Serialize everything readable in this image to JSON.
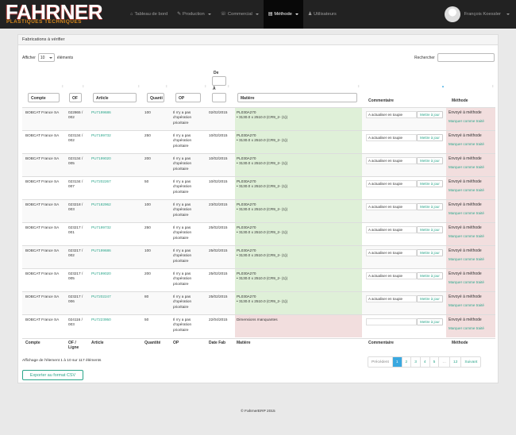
{
  "brand": {
    "name": "FAHRNER",
    "tagline": "PLASTIQUES TECHNIQUES"
  },
  "nav": {
    "items": [
      {
        "icon": "home-icon",
        "glyph": "⌂",
        "label": "Tableau de bord",
        "caret": false,
        "active": false
      },
      {
        "icon": "wrench-icon",
        "glyph": "✎",
        "label": "Production",
        "caret": true,
        "active": false
      },
      {
        "icon": "phone-icon",
        "glyph": "☏",
        "label": "Commercial",
        "caret": true,
        "active": false
      },
      {
        "icon": "book-icon",
        "glyph": "▤",
        "label": "Méthode",
        "caret": true,
        "active": true
      },
      {
        "icon": "user-icon",
        "glyph": "♟",
        "label": "Utilisateurs",
        "caret": false,
        "active": false
      }
    ]
  },
  "user": {
    "name": "François Koessler"
  },
  "panel": {
    "title": "Fabrications à vérifier"
  },
  "length": {
    "prefix": "Afficher",
    "value": "10",
    "suffix": "éléments"
  },
  "search": {
    "label": "Rechercher",
    "value": ""
  },
  "filters": {
    "compte": "Compte",
    "of": "OF",
    "article": "Article",
    "quantite": "Quanti",
    "op": "OP",
    "date_from": "De",
    "date_to": "À",
    "matiere": "Matière"
  },
  "headers": {
    "commentaire": "Commentaire",
    "methode": "Méthode"
  },
  "footer_headers": {
    "compte": "Compte",
    "of": "OF / Ligne",
    "article": "Article",
    "quantite": "Quantité",
    "op": "OP",
    "date": "Date Fab",
    "matiere": "Matière",
    "commentaire": "Commentaire",
    "methode": "Méthode"
  },
  "rows": [
    {
      "compte": "BOBCAT France SA",
      "of": "022865 / 002",
      "article": "PU7199686",
      "qty": "100",
      "op": "Il n'y a pas d'opération prioritaire",
      "date": "02/02/2015",
      "mat1": "PL030A270",
      "mat2": "• 3130.0 x 2510.0 (CR9_2- (1))",
      "mat_ok": true,
      "comment": "A actualiser en toupie",
      "update": "Mettre à jour",
      "status": "Envoyé à méthode",
      "mark": "Marquer comme traité"
    },
    {
      "compte": "BOBCAT France SA",
      "of": "023134 / 002",
      "article": "PU7199732",
      "qty": "250",
      "op": "Il n'y a pas d'opération prioritaire",
      "date": "10/02/2015",
      "mat1": "PL030A270",
      "mat2": "• 3130.0 x 2510.0 (CR9_2- (1))",
      "mat_ok": true,
      "comment": "A actualiser en toupie",
      "update": "Mettre à jour",
      "status": "Envoyé à méthode",
      "mark": "Marquer comme traité"
    },
    {
      "compte": "BOBCAT France SA",
      "of": "023134 / 005",
      "article": "PU7199020",
      "qty": "200",
      "op": "Il n'y a pas d'opération prioritaire",
      "date": "10/02/2015",
      "mat1": "PL030A270",
      "mat2": "• 3130.0 x 2510.0 (CR9_2- (1))",
      "mat_ok": true,
      "comment": "A actualiser en toupie",
      "update": "Mettre à jour",
      "status": "Envoyé à méthode",
      "mark": "Marquer comme traité"
    },
    {
      "compte": "BOBCAT France SA",
      "of": "023134 / 007",
      "article": "PU7202267",
      "qty": "50",
      "op": "Il n'y a pas d'opération prioritaire",
      "date": "10/02/2015",
      "mat1": "PL030A270",
      "mat2": "• 3130.0 x 2510.0 (CR9_2- (1))",
      "mat_ok": true,
      "comment": "A actualiser en toupie",
      "update": "Mettre à jour",
      "status": "Envoyé à méthode",
      "mark": "Marquer comme traité"
    },
    {
      "compte": "BOBCAT France SA",
      "of": "023218 / 003",
      "article": "PU7182962",
      "qty": "100",
      "op": "Il n'y a pas d'opération prioritaire",
      "date": "23/02/2015",
      "mat1": "PL030A270",
      "mat2": "• 3130.0 x 2510.0 (CR9_2- (1))",
      "mat_ok": true,
      "comment": "A actualiser en toupie",
      "update": "Mettre à jour",
      "status": "Envoyé à méthode",
      "mark": "Marquer comme traité"
    },
    {
      "compte": "BOBCAT France SA",
      "of": "023217 / 001",
      "article": "PU7199732",
      "qty": "250",
      "op": "Il n'y a pas d'opération prioritaire",
      "date": "25/02/2015",
      "mat1": "PL030A270",
      "mat2": "• 3130.0 x 2510.0 (CR9_2- (1))",
      "mat_ok": true,
      "comment": "A actualiser en toupie",
      "update": "Mettre à jour",
      "status": "Envoyé à méthode",
      "mark": "Marquer comme traité"
    },
    {
      "compte": "BOBCAT France SA",
      "of": "023217 / 002",
      "article": "PU7199686",
      "qty": "100",
      "op": "Il n'y a pas d'opération prioritaire",
      "date": "25/02/2015",
      "mat1": "PL030A270",
      "mat2": "• 3130.0 x 2510.0 (CR9_2- (1))",
      "mat_ok": true,
      "comment": "A actualiser en toupie",
      "update": "Mettre à jour",
      "status": "Envoyé à méthode",
      "mark": "Marquer comme traité"
    },
    {
      "compte": "BOBCAT France SA",
      "of": "023217 / 005",
      "article": "PU7199020",
      "qty": "200",
      "op": "Il n'y a pas d'opération prioritaire",
      "date": "25/02/2015",
      "mat1": "PL030A270",
      "mat2": "• 3130.0 x 2510.0 (CR9_2- (1))",
      "mat_ok": true,
      "comment": "A actualiser en toupie",
      "update": "Mettre à jour",
      "status": "Envoyé à méthode",
      "mark": "Marquer comme traité"
    },
    {
      "compte": "BOBCAT France SA",
      "of": "023217 / 006",
      "article": "PU7202247",
      "qty": "80",
      "op": "Il n'y a pas d'opération prioritaire",
      "date": "25/02/2015",
      "mat1": "PL030A270",
      "mat2": "• 3130.0 x 2510.0 (CR9_2- (1))",
      "mat_ok": true,
      "comment": "A actualiser en toupie",
      "update": "Mettre à jour",
      "status": "Envoyé à méthode",
      "mark": "Marquer comme traité"
    },
    {
      "compte": "BOBCAT France SA",
      "of": "024116 / 003",
      "article": "PU7223950",
      "qty": "50",
      "op": "Il n'y a pas d'opération prioritaire",
      "date": "22/04/2015",
      "mat1": "Dimensions manquantes",
      "mat2": "",
      "mat_ok": false,
      "comment": "",
      "update": "Mettre à jour",
      "status": "Envoyé à méthode",
      "mark": "Marquer comme traité"
    }
  ],
  "info": "Affichage de l'élement 1 à 10 sur 117 éléments",
  "pagination": {
    "prev": "Précédent",
    "pages": [
      "1",
      "2",
      "3",
      "4",
      "5",
      "…",
      "12"
    ],
    "next": "Suivant"
  },
  "export": "Exporter au format CSV",
  "copyright": "© FahrnerERP 2015"
}
